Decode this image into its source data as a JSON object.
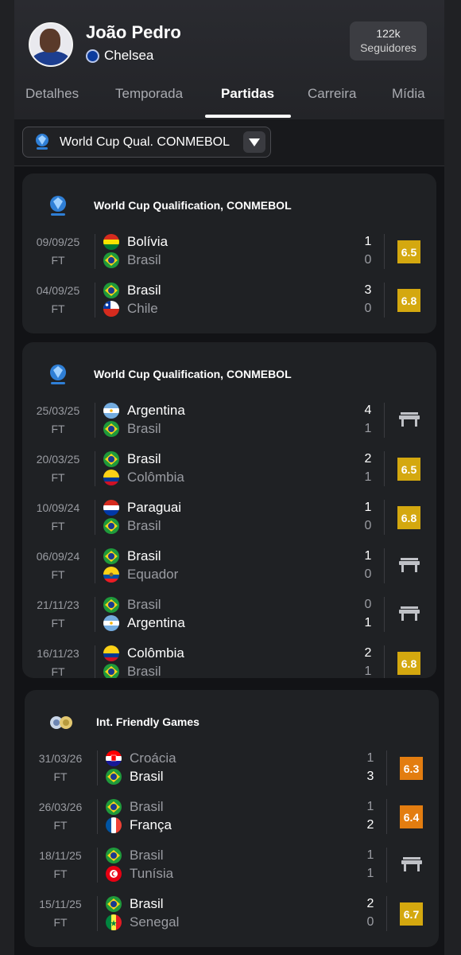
{
  "player": {
    "name": "João Pedro",
    "club": "Chelsea",
    "followers_count": "122k",
    "followers_label": "Seguidores"
  },
  "tabs": [
    {
      "label": "Detalhes",
      "active": false
    },
    {
      "label": "Temporada",
      "active": false
    },
    {
      "label": "Partidas",
      "active": true
    },
    {
      "label": "Carreira",
      "active": false
    },
    {
      "label": "Mídia",
      "active": false
    }
  ],
  "filter": {
    "selected": "World Cup Qual. CONMEBOL"
  },
  "colors": {
    "rating_yellow": "#d4a80f",
    "rating_orange": "#e37d10",
    "accent_white": "#ffffff"
  },
  "sections": [
    {
      "title": "World Cup Qualification, CONMEBOL",
      "icon": "conmebol-icon",
      "matches": [
        {
          "date": "09/09/25",
          "status": "FT",
          "home": "Bolívia",
          "home_flag": "bolivia",
          "away": "Brasil",
          "away_flag": "brazil",
          "home_score": "1",
          "away_score": "0",
          "home_bold": true,
          "away_bold": false,
          "rating": "6.5",
          "rating_color": "yellow",
          "bench": false
        },
        {
          "date": "04/09/25",
          "status": "FT",
          "home": "Brasil",
          "home_flag": "brazil",
          "away": "Chile",
          "away_flag": "chile",
          "home_score": "3",
          "away_score": "0",
          "home_bold": true,
          "away_bold": false,
          "rating": "6.8",
          "rating_color": "yellow",
          "bench": false
        }
      ]
    },
    {
      "title": "World Cup Qualification, CONMEBOL",
      "icon": "conmebol-icon",
      "matches": [
        {
          "date": "25/03/25",
          "status": "FT",
          "home": "Argentina",
          "home_flag": "argentina",
          "away": "Brasil",
          "away_flag": "brazil",
          "home_score": "4",
          "away_score": "1",
          "home_bold": true,
          "away_bold": false,
          "rating": "",
          "rating_color": "",
          "bench": true
        },
        {
          "date": "20/03/25",
          "status": "FT",
          "home": "Brasil",
          "home_flag": "brazil",
          "away": "Colômbia",
          "away_flag": "colombia",
          "home_score": "2",
          "away_score": "1",
          "home_bold": true,
          "away_bold": false,
          "rating": "6.5",
          "rating_color": "yellow",
          "bench": false
        },
        {
          "date": "10/09/24",
          "status": "FT",
          "home": "Paraguai",
          "home_flag": "paraguay",
          "away": "Brasil",
          "away_flag": "brazil",
          "home_score": "1",
          "away_score": "0",
          "home_bold": true,
          "away_bold": false,
          "rating": "6.8",
          "rating_color": "yellow",
          "bench": false
        },
        {
          "date": "06/09/24",
          "status": "FT",
          "home": "Brasil",
          "home_flag": "brazil",
          "away": "Equador",
          "away_flag": "ecuador",
          "home_score": "1",
          "away_score": "0",
          "home_bold": true,
          "away_bold": false,
          "rating": "",
          "rating_color": "",
          "bench": true
        },
        {
          "date": "21/11/23",
          "status": "FT",
          "home": "Brasil",
          "home_flag": "brazil",
          "away": "Argentina",
          "away_flag": "argentina",
          "home_score": "0",
          "away_score": "1",
          "home_bold": false,
          "away_bold": true,
          "rating": "",
          "rating_color": "",
          "bench": true
        },
        {
          "date": "16/11/23",
          "status": "FT",
          "home": "Colômbia",
          "home_flag": "colombia",
          "away": "Brasil",
          "away_flag": "brazil",
          "home_score": "2",
          "away_score": "1",
          "home_bold": true,
          "away_bold": false,
          "rating": "6.8",
          "rating_color": "yellow",
          "bench": false
        }
      ]
    },
    {
      "title": "Int. Friendly Games",
      "icon": "friendly-games-icon",
      "matches": [
        {
          "date": "31/03/26",
          "status": "FT",
          "home": "Croácia",
          "home_flag": "croatia",
          "away": "Brasil",
          "away_flag": "brazil",
          "home_score": "1",
          "away_score": "3",
          "home_bold": false,
          "away_bold": true,
          "rating": "6.3",
          "rating_color": "orange",
          "bench": false
        },
        {
          "date": "26/03/26",
          "status": "FT",
          "home": "Brasil",
          "home_flag": "brazil",
          "away": "França",
          "away_flag": "france",
          "home_score": "1",
          "away_score": "2",
          "home_bold": false,
          "away_bold": true,
          "rating": "6.4",
          "rating_color": "orange",
          "bench": false
        },
        {
          "date": "18/11/25",
          "status": "FT",
          "home": "Brasil",
          "home_flag": "brazil",
          "away": "Tunísia",
          "away_flag": "tunisia",
          "home_score": "1",
          "away_score": "1",
          "home_bold": false,
          "away_bold": false,
          "rating": "",
          "rating_color": "",
          "bench": true
        },
        {
          "date": "15/11/25",
          "status": "FT",
          "home": "Brasil",
          "home_flag": "brazil",
          "away": "Senegal",
          "away_flag": "senegal",
          "home_score": "2",
          "away_score": "0",
          "home_bold": true,
          "away_bold": false,
          "rating": "6.7",
          "rating_color": "yellow",
          "bench": false
        }
      ]
    }
  ]
}
